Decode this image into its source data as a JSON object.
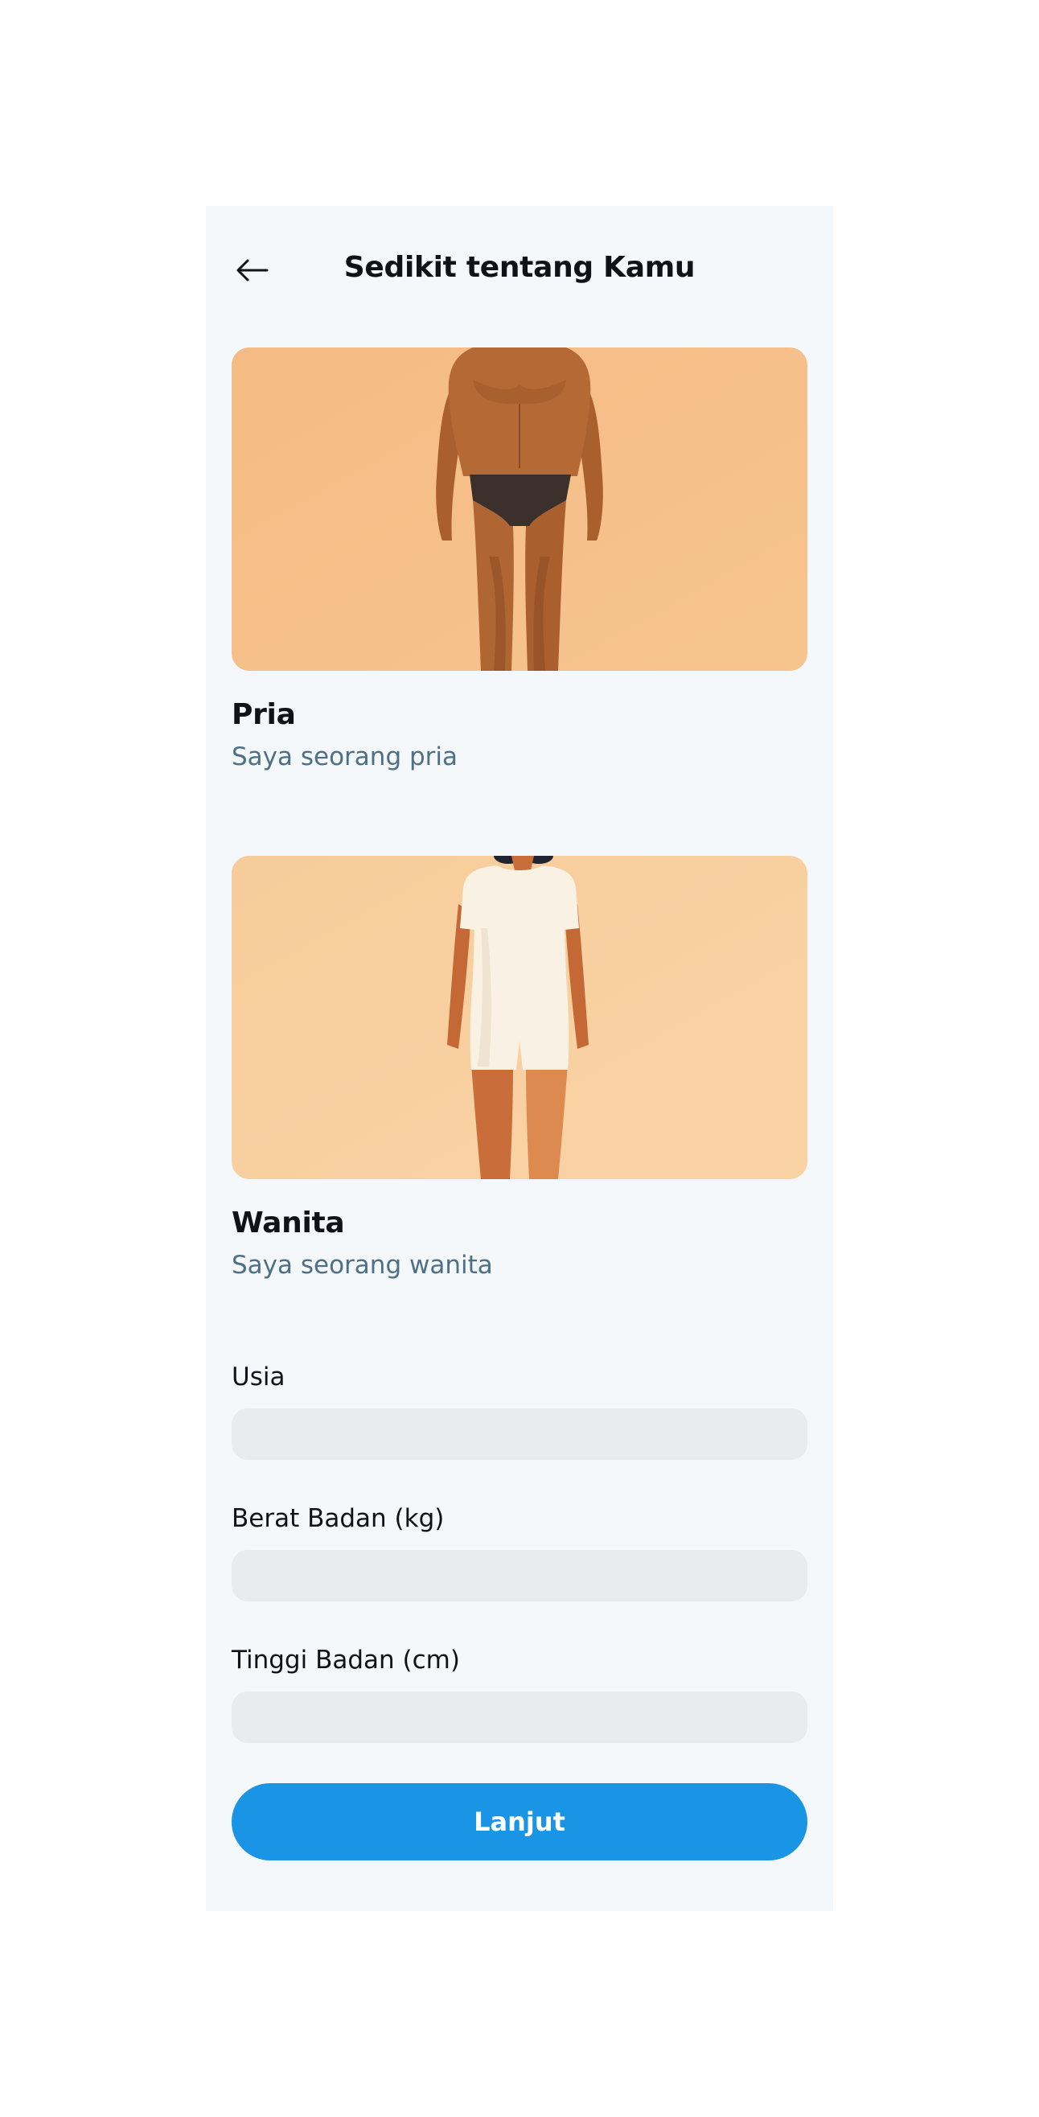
{
  "header": {
    "title": "Sedikit tentang Kamu",
    "back_icon": "arrow-left-icon"
  },
  "options": [
    {
      "title": "Pria",
      "subtitle": "Saya seorang pria",
      "image": "male-body-illustration",
      "bg_color": "#f6c08a"
    },
    {
      "title": "Wanita",
      "subtitle": "Saya seorang wanita",
      "image": "female-body-illustration",
      "bg_color": "#f9d1a2"
    }
  ],
  "form": {
    "age": {
      "label": "Usia",
      "value": ""
    },
    "weight": {
      "label": "Berat Badan (kg)",
      "value": ""
    },
    "height": {
      "label": "Tinggi Badan (cm)",
      "value": ""
    }
  },
  "cta": {
    "label": "Lanjut"
  },
  "colors": {
    "primary": "#1a94e4",
    "subtitle": "#4e7087",
    "screen_bg": "#f5f8fa",
    "input_bg": "#e8ecef"
  }
}
